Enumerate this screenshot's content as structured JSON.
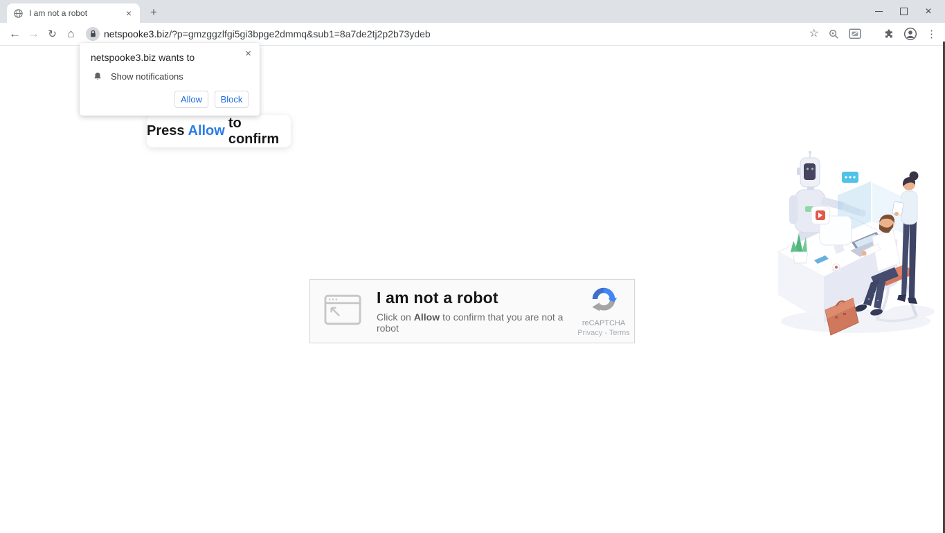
{
  "browser": {
    "tab_title": "I am not a robot",
    "tab_close_glyph": "×",
    "new_tab_glyph": "+",
    "window_close_glyph": "×",
    "toolbar": {
      "back_glyph": "←",
      "forward_glyph": "→",
      "reload_glyph": "↻",
      "home_glyph": "⌂",
      "url_domain": "netspooke3.biz",
      "url_path": "/?p=gmzggzlfgi5gi3bpge2dmmq&sub1=8a7de2tj2p2b73ydeb",
      "bookmark_glyph": "☆",
      "menu_glyph": "⋮"
    }
  },
  "notification_dialog": {
    "title": "netspooke3.biz wants to",
    "permission_label": "Show notifications",
    "allow_label": "Allow",
    "block_label": "Block",
    "close_glyph": "×"
  },
  "confirm_banner": {
    "pre": "Press",
    "highlight": "Allow",
    "post": "to confirm"
  },
  "captcha_card": {
    "title": "I am not a robot",
    "subtitle_pre": "Click on",
    "subtitle_highlight": "Allow",
    "subtitle_post": "to confirm that you are not a robot",
    "brand": "reCAPTCHA",
    "links": "Privacy - Terms"
  },
  "colors": {
    "accent_blue": "#1f6ce0",
    "banner_allow_blue": "#2b7ce9",
    "recaptcha_blue": "#4285f4",
    "recaptcha_gray": "#a5a5a5",
    "stool_orange": "#e08266",
    "titlebar_gray": "#dee1e6"
  }
}
